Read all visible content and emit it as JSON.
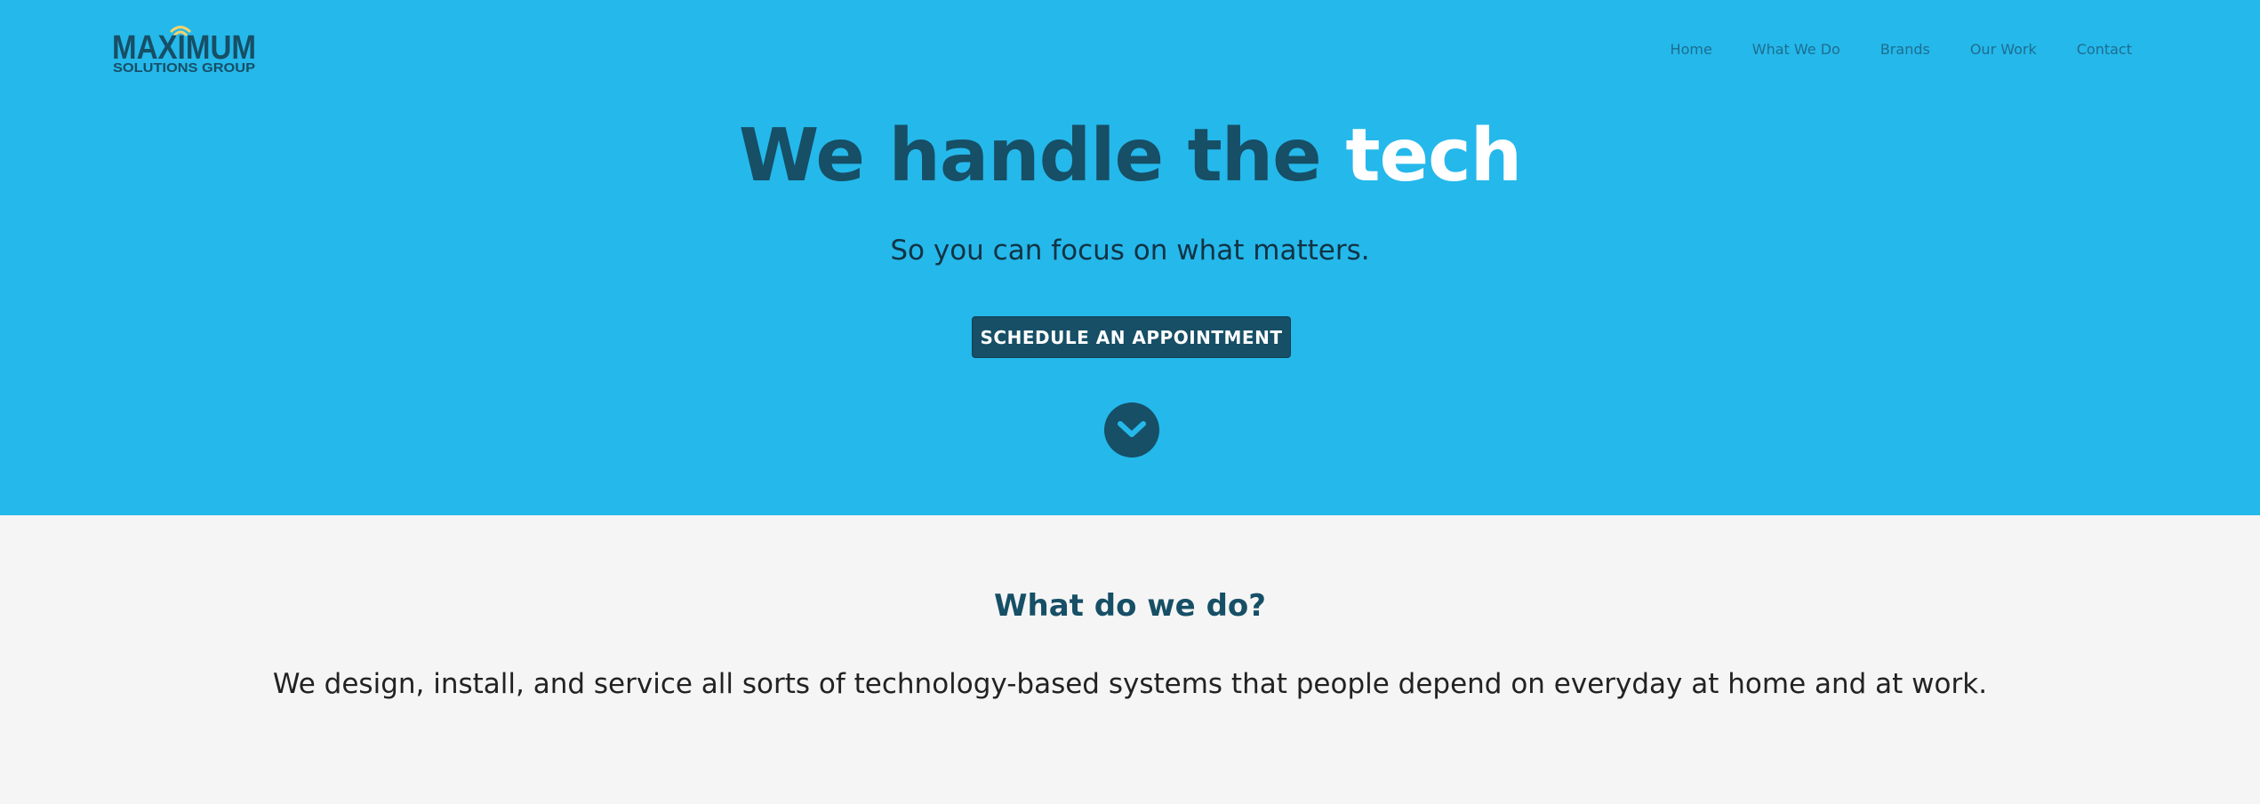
{
  "brand": {
    "logo_text_main": "MAXIMUM",
    "logo_text_sub": "SOLUTIONS GROUP",
    "logo_color": "#164f66",
    "logo_accent_color": "#f3d36b"
  },
  "nav": {
    "items": [
      {
        "label": "Home"
      },
      {
        "label": "What We Do"
      },
      {
        "label": "Brands"
      },
      {
        "label": "Our Work"
      },
      {
        "label": "Contact"
      }
    ]
  },
  "hero": {
    "headline_main": "We handle the ",
    "headline_accent": "tech",
    "subheadline": "So you can focus on what matters.",
    "cta_label": "SCHEDULE AN APPOINTMENT",
    "scroll_icon": "chevron-down-icon",
    "background_color": "#25b8eb",
    "dark_color": "#164f66"
  },
  "section": {
    "title": "What do we do?",
    "text": "We design, install, and service all sorts of technology-based systems that people depend on everyday at home and at work."
  }
}
